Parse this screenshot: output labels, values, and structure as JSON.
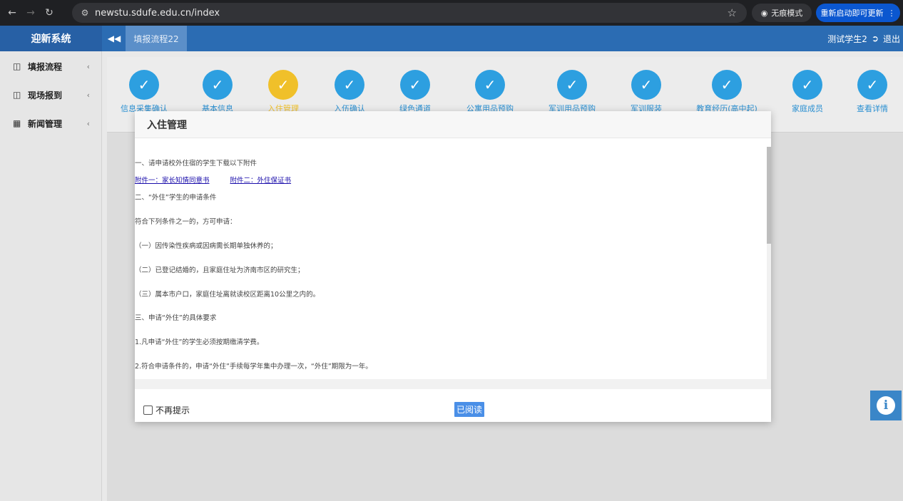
{
  "browser": {
    "url": "newstu.sdufe.edu.cn/index",
    "incognito_label": "无痕模式",
    "update_label": "重新启动即可更新"
  },
  "header": {
    "brand": "迎新系统",
    "tab": "填报流程22",
    "user": "测试学生2",
    "logout": "退出"
  },
  "sidebar": {
    "items": [
      {
        "label": "填报流程"
      },
      {
        "label": "现场报到"
      },
      {
        "label": "新闻管理"
      }
    ]
  },
  "steps": [
    {
      "label": "信息采集确认",
      "state": "done"
    },
    {
      "label": "基本信息",
      "state": "done"
    },
    {
      "label": "入住管理",
      "state": "active"
    },
    {
      "label": "入伍确认",
      "state": "done"
    },
    {
      "label": "绿色通道",
      "state": "done"
    },
    {
      "label": "公寓用品预购",
      "state": "done"
    },
    {
      "label": "军训用品预购",
      "state": "done"
    },
    {
      "label": "军训服装",
      "state": "done"
    },
    {
      "label": "教育经历(高中起)",
      "state": "done"
    },
    {
      "label": "家庭成员",
      "state": "done"
    },
    {
      "label": "查看详情",
      "state": "done"
    }
  ],
  "modal": {
    "title": "入住管理",
    "lines": {
      "l1": "一、请申请校外住宿的学生下载以下附件",
      "link1": "附件一：家长知情同意书",
      "link2": "附件二：外住保证书",
      "l2": "二、“外住”学生的申请条件",
      "l3": "符合下列条件之一的，方可申请：",
      "l4": "（一）因传染性疾病或因病需长期单独休养的；",
      "l5": "（二）已登记结婚的，且家庭住址为济南市区的研究生；",
      "l6": "（三）属本市户口，家庭住址离就读校区距离10公里之内的。",
      "l7": "三、申请“外住”的具体要求",
      "l8": "1.凡申请“外住”的学生必须按期缴清学费。",
      "l9": "2.符合申请条件的，申请“外住”手续每学年集中办理一次，“外住”期限为一年。"
    },
    "checkbox_label": "不再提示",
    "confirm_label": "已阅读"
  },
  "colors": {
    "appbar": "#2b6cb3",
    "step_done": "#2d9fe0",
    "step_active": "#f0c02a"
  }
}
